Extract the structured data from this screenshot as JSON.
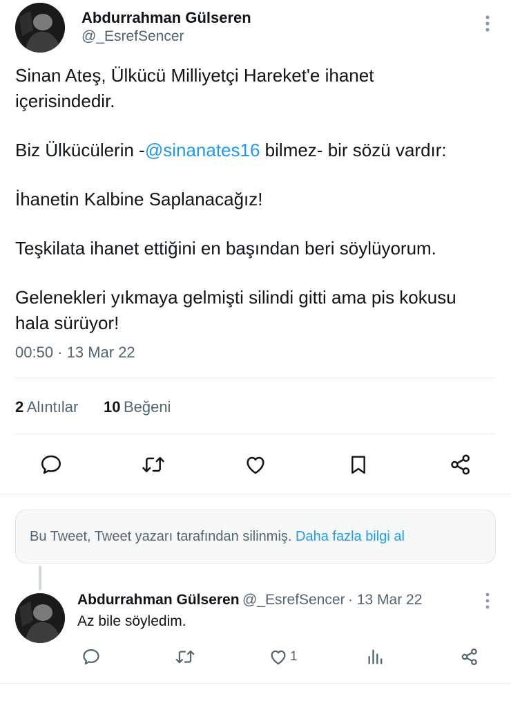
{
  "main_tweet": {
    "author_name": "Abdurrahman Gülseren",
    "author_handle": "@_EsrefSencer",
    "lines": [
      "Sinan Ateş, Ülkücü Milliyetçi Hareket'e ihanet",
      "içerisindedir.",
      "İhanetin Kalbine Saplanacağız!",
      "Teşkilata ihanet ettiğini en başından beri söylüyorum.",
      "Gelenekleri yıkmaya gelmişti silindi gitti ama pis kokusu",
      "hala sürüyor!"
    ],
    "mention_line": {
      "prefix": "Biz Ülkücülerin -",
      "mention": "@sinanates16",
      "suffix": " bilmez- bir sözü vardır:"
    },
    "timestamp": "00:50 · 13 Mar 22",
    "stats": {
      "quotes_count": "2",
      "quotes_label": "Alıntılar",
      "likes_count": "10",
      "likes_label": "Beğeni"
    },
    "actions": [
      "reply-icon",
      "retweet-icon",
      "like-icon",
      "bookmark-icon",
      "share-icon"
    ]
  },
  "deleted_notice": {
    "text": "Bu Tweet, Tweet yazarı tarafından silinmiş.",
    "link": "Daha fazla bilgi al"
  },
  "reply": {
    "author_name": "Abdurrahman Gülseren",
    "author_handle": "@_EsrefSencer",
    "date": "· 13 Mar 22",
    "text": "Az bile söyledim.",
    "like_count": "1",
    "actions": [
      "reply-icon",
      "retweet-icon",
      "like-icon",
      "views-icon",
      "share-icon"
    ]
  },
  "colors": {
    "accent": "#1d9bf0",
    "text": "#0f1419",
    "secondary": "#536471",
    "border": "#e6ecf0"
  }
}
